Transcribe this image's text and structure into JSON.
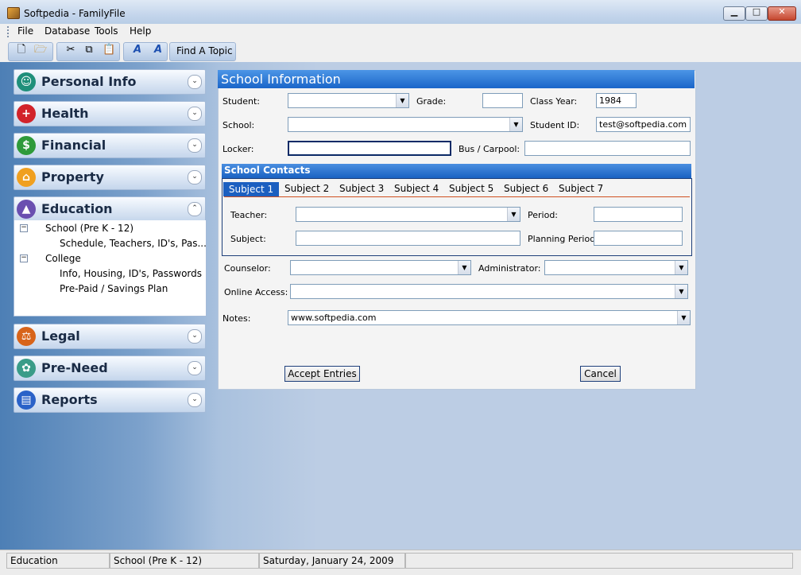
{
  "window": {
    "title": "Softpedia - FamilyFile"
  },
  "menu": [
    "File",
    "Database",
    "Tools",
    "Help"
  ],
  "toolbar": {
    "find_topic": "Find A Topic"
  },
  "nav": {
    "personal": "Personal Info",
    "health": "Health",
    "financial": "Financial",
    "property": "Property",
    "education": "Education",
    "legal": "Legal",
    "preneed": "Pre-Need",
    "reports": "Reports"
  },
  "tree": {
    "school": "School (Pre K - 12)",
    "school_child": "Schedule, Teachers, ID's, Pas...",
    "college": "College",
    "college_child1": "Info, Housing, ID's, Passwords",
    "college_child2": "Pre-Paid / Savings Plan"
  },
  "form": {
    "title": "School Information",
    "student_label": "Student:",
    "student_value": "",
    "grade_label": "Grade:",
    "grade_value": "",
    "class_year_label": "Class Year:",
    "class_year_value": "1984",
    "school_label": "School:",
    "school_value": "",
    "student_id_label": "Student ID:",
    "student_id_value": "test@softpedia.com",
    "locker_label": "Locker:",
    "locker_value": "",
    "bus_label": "Bus / Carpool:",
    "bus_value": "",
    "contacts_title": "School Contacts",
    "tabs": [
      "Subject 1",
      "Subject 2",
      "Subject 3",
      "Subject 4",
      "Subject 5",
      "Subject 6",
      "Subject 7"
    ],
    "teacher_label": "Teacher:",
    "period_label": "Period:",
    "subject_label": "Subject:",
    "planning_label": "Planning Period:",
    "counselor_label": "Counselor:",
    "administrator_label": "Administrator:",
    "online_label": "Online Access:",
    "notes_label": "Notes:",
    "notes_value": "www.softpedia.com",
    "accept": "Accept Entries",
    "cancel": "Cancel"
  },
  "status": {
    "section": "Education",
    "subsection": "School (Pre K - 12)",
    "date": "Saturday, January 24, 2009"
  },
  "colors": {
    "accent": "#1b66c9",
    "nav_bg": "#4d7fb5"
  }
}
